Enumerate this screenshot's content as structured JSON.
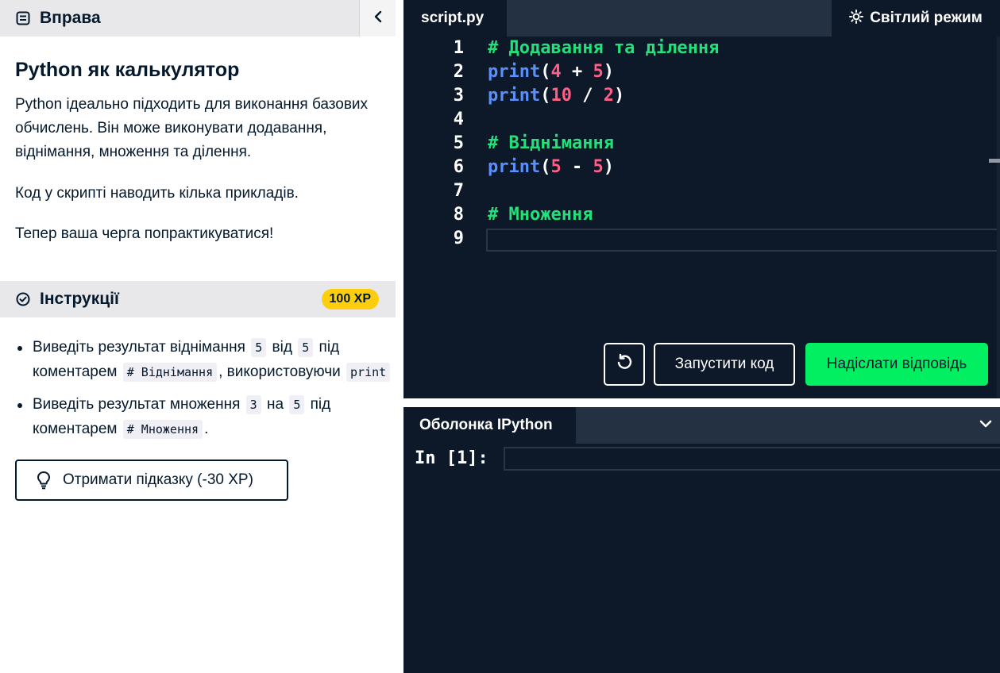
{
  "exercise": {
    "header": "Вправа",
    "title": "Python як калькулятор",
    "paragraphs": [
      "Python ідеально підходить для виконання базових обчислень. Він може виконувати додавання, віднімання, множення та ділення.",
      "Код у скрипті наводить кілька прикладів.",
      "Тепер ваша черга попрактикуватися!"
    ]
  },
  "instructions": {
    "header": "Інструкції",
    "xp": "100 XP",
    "items": [
      {
        "l1a": "Виведіть результат віднімання",
        "c1": "5",
        "l1b": "від",
        "c2": "5",
        "l1c": "під",
        "l2a": "коментарем",
        "c3": "# Віднімання",
        "l2b": ", використовуючи",
        "c4": "print"
      },
      {
        "l1a": "Виведіть результат множення",
        "c1": "3",
        "l1b": "на",
        "c2": "5",
        "l1c": "під",
        "l2a": "коментарем",
        "c3": "# Множення",
        "l2b": "."
      }
    ],
    "hint_button": "Отримати підказку (-30 XP)"
  },
  "editor": {
    "tab": "script.py",
    "light_mode": "Світлий режим",
    "lines": [
      {
        "n": "1",
        "parts": [
          {
            "t": "# Додавання та ділення",
            "c": "cm"
          }
        ]
      },
      {
        "n": "2",
        "parts": [
          {
            "t": "print",
            "c": "kw"
          },
          {
            "t": "(",
            "c": "pn"
          },
          {
            "t": "4",
            "c": "nm"
          },
          {
            "t": " + ",
            "c": "pn"
          },
          {
            "t": "5",
            "c": "nm"
          },
          {
            "t": ")",
            "c": "pn"
          }
        ]
      },
      {
        "n": "3",
        "parts": [
          {
            "t": "print",
            "c": "kw"
          },
          {
            "t": "(",
            "c": "pn"
          },
          {
            "t": "10",
            "c": "nm"
          },
          {
            "t": " / ",
            "c": "pn"
          },
          {
            "t": "2",
            "c": "nm"
          },
          {
            "t": ")",
            "c": "pn"
          }
        ]
      },
      {
        "n": "4",
        "parts": []
      },
      {
        "n": "5",
        "parts": [
          {
            "t": "# Віднімання",
            "c": "cm"
          }
        ]
      },
      {
        "n": "6",
        "parts": [
          {
            "t": "print",
            "c": "kw"
          },
          {
            "t": "(",
            "c": "pn"
          },
          {
            "t": "5",
            "c": "nm"
          },
          {
            "t": " - ",
            "c": "pn"
          },
          {
            "t": "5",
            "c": "nm"
          },
          {
            "t": ")",
            "c": "pn"
          }
        ]
      },
      {
        "n": "7",
        "parts": []
      },
      {
        "n": "8",
        "parts": [
          {
            "t": "# Множення",
            "c": "cm"
          }
        ]
      },
      {
        "n": "9",
        "parts": []
      }
    ],
    "run_button": "Запустити код",
    "submit_button": "Надіслати відповідь"
  },
  "shell": {
    "tab": "Оболонка IPython",
    "prompt": "In [1]:"
  },
  "colors": {
    "accent_green": "#03ef62",
    "xp_yellow": "#fcce0d",
    "editor_bg": "#0d1828"
  }
}
